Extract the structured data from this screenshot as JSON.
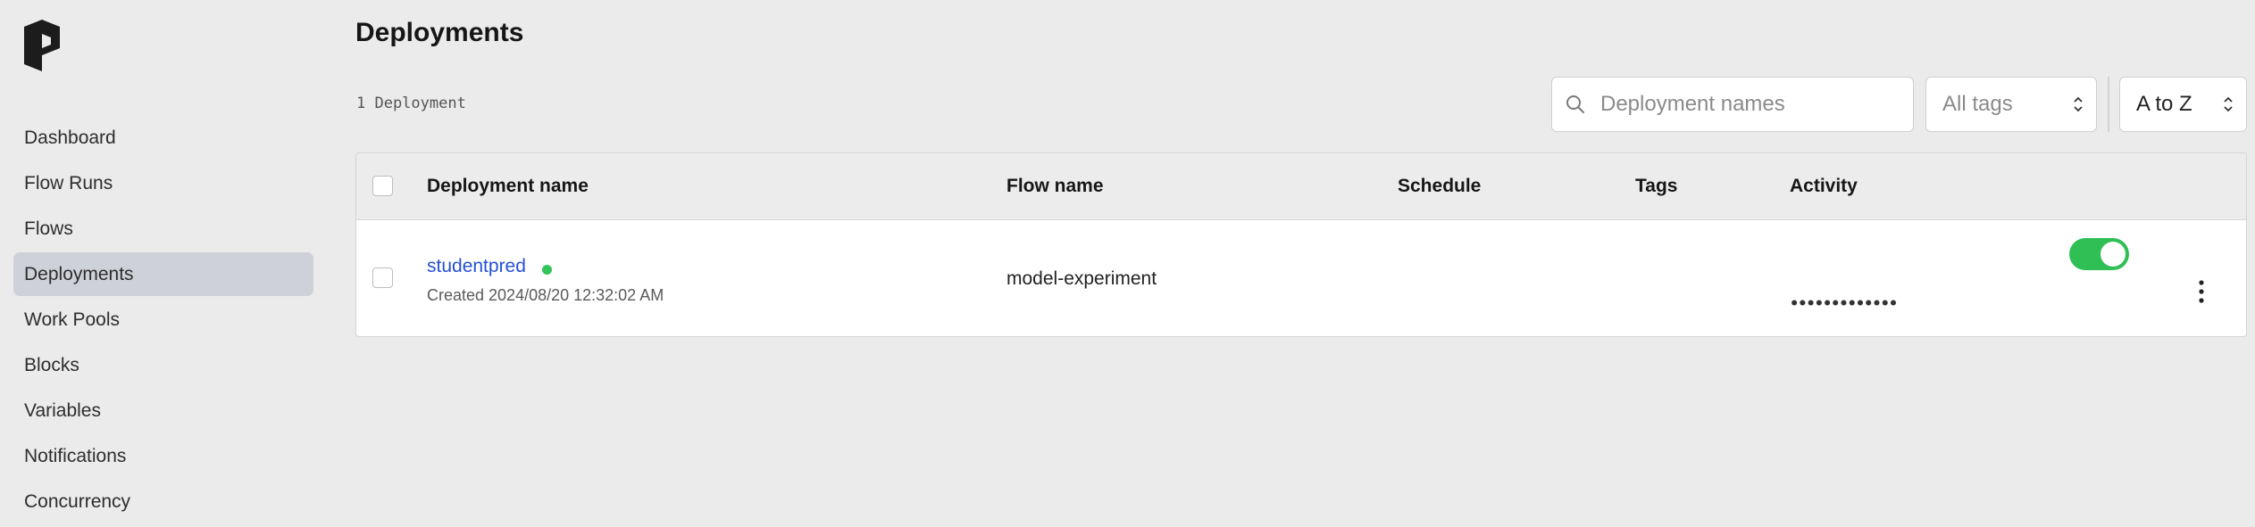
{
  "nav": {
    "items": [
      {
        "label": "Dashboard"
      },
      {
        "label": "Flow Runs"
      },
      {
        "label": "Flows"
      },
      {
        "label": "Deployments",
        "active": true
      },
      {
        "label": "Work Pools"
      },
      {
        "label": "Blocks"
      },
      {
        "label": "Variables"
      },
      {
        "label": "Notifications"
      },
      {
        "label": "Concurrency"
      }
    ]
  },
  "header": {
    "title": "Deployments",
    "count": "1 Deployment"
  },
  "filters": {
    "search_placeholder": "Deployment names",
    "tags_value": "All tags",
    "sort_value": "A to Z"
  },
  "table": {
    "columns": [
      "Deployment name",
      "Flow name",
      "Schedule",
      "Tags",
      "Activity"
    ],
    "rows": [
      {
        "name": "studentpred",
        "status_color": "#33c55a",
        "created": "Created 2024/08/20 12:32:02 AM",
        "flow": "model-experiment",
        "schedule": "",
        "tags": "",
        "activity": "•••••••••••••",
        "enabled": true
      }
    ]
  },
  "colors": {
    "accent": "#2450d6",
    "toggle_on": "#2fbf54",
    "active_nav_bg": "#cfd1d9"
  },
  "icons": [
    "prefect-logo-icon",
    "search-icon",
    "chevron-updown-icon",
    "kebab-menu-icon"
  ]
}
